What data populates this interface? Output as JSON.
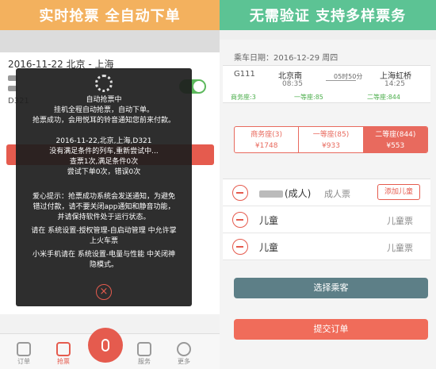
{
  "left": {
    "banner": "实时抢票 全自动下单",
    "trip_title": "2016-11-22 北京 - 上海",
    "train_code": "D321",
    "overlay": {
      "line1": "自动抢票中",
      "line2": "挂机全程自动抢票，自动下单。",
      "line3": "抢票成功，会用悦耳的铃音通知您前来付款。",
      "line4": "2016-11-22,北京,上海,D321",
      "line5": "没有满足条件的列车,重新尝试中...",
      "line6": "查票1次,满足条件0次",
      "line7": "尝试下单0次，错误0次",
      "line8": "爱心提示：抢票成功系统会发送通知，为避免",
      "line9": "错过付款，请不要关闭app通知和静音功能，",
      "line10": "并请保持软件处于运行状态。",
      "line11": "请在 系统设置-授权管理-自启动管理 中允许掌",
      "line12": "上火车票",
      "line13": "小米手机请在 系统设置-电量与性能 中关闭神",
      "line14": "隐模式。",
      "close_icon": "×"
    },
    "nav": [
      {
        "label": "订单",
        "icon": "order-icon"
      },
      {
        "label": "抢票",
        "icon": "ticket-icon"
      },
      {
        "label": "",
        "icon": "mic-icon"
      },
      {
        "label": "服务",
        "icon": "cart-icon"
      },
      {
        "label": "更多",
        "icon": "user-icon"
      }
    ],
    "colors": {
      "accent": "#e55b4e",
      "banner": "#f3b15e"
    }
  },
  "right": {
    "banner": "无需验证 支持多样票务",
    "ride_date": "乘车日期：2016-12-29 周四",
    "train": {
      "number": "G111",
      "from_station": "北京南",
      "from_time": "08:35",
      "duration": "05时50分",
      "to_station": "上海虹桥",
      "to_time": "14:25",
      "seat_business": "商务座:3",
      "seat_first": "一等座:85",
      "seat_second": "二等座:844"
    },
    "seat_tabs": [
      {
        "name": "商务座(3)",
        "price": "¥1748"
      },
      {
        "name": "一等座(85)",
        "price": "¥933"
      },
      {
        "name": "二等座(844)",
        "price": "¥553"
      }
    ],
    "passengers": [
      {
        "name": "(成人)",
        "type": "成人票"
      },
      {
        "name": "儿童",
        "type": "儿童票"
      },
      {
        "name": "儿童",
        "type": "儿童票"
      }
    ],
    "add_child": "添加儿童",
    "select_passenger": "选择乘客",
    "submit_order": "提交订单",
    "colors": {
      "banner": "#5cc394",
      "accent": "#e86a5e",
      "select_btn": "#5d7f87"
    }
  }
}
